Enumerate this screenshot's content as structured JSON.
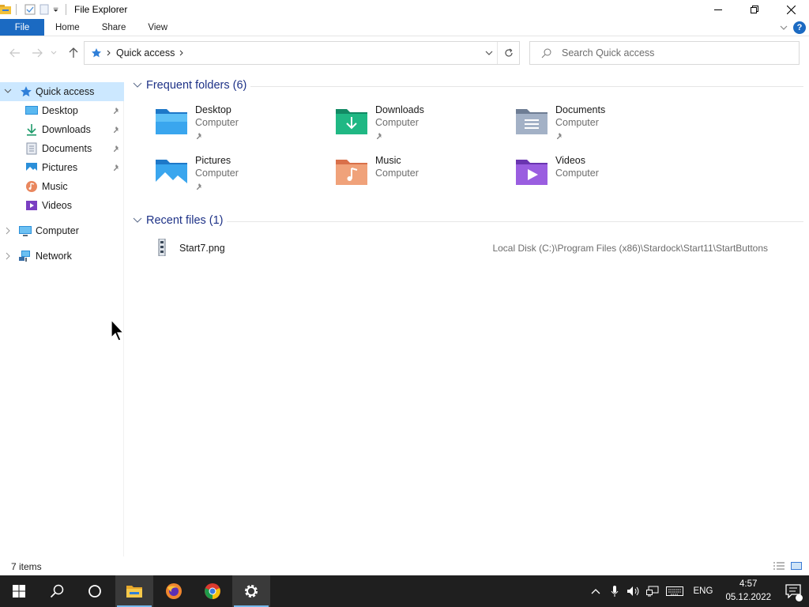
{
  "window": {
    "title": "File Explorer"
  },
  "ribbon": {
    "tabs": [
      "File",
      "Home",
      "Share",
      "View"
    ]
  },
  "address": {
    "location": "Quick access"
  },
  "search": {
    "placeholder": "Search Quick access"
  },
  "nav": {
    "quick_access": "Quick access",
    "items": [
      {
        "label": "Desktop",
        "icon": "desktop-icon",
        "pinned": true
      },
      {
        "label": "Downloads",
        "icon": "downloads-icon",
        "pinned": true
      },
      {
        "label": "Documents",
        "icon": "documents-icon",
        "pinned": true
      },
      {
        "label": "Pictures",
        "icon": "pictures-icon",
        "pinned": true
      },
      {
        "label": "Music",
        "icon": "music-icon",
        "pinned": false
      },
      {
        "label": "Videos",
        "icon": "videos-icon",
        "pinned": false
      }
    ],
    "computer": "Computer",
    "network": "Network"
  },
  "content": {
    "frequent_header": "Frequent folders (6)",
    "folders": [
      {
        "name": "Desktop",
        "sub": "Computer",
        "pinned": true,
        "icon": "desktop-folder-icon"
      },
      {
        "name": "Downloads",
        "sub": "Computer",
        "pinned": true,
        "icon": "downloads-folder-icon"
      },
      {
        "name": "Documents",
        "sub": "Computer",
        "pinned": true,
        "icon": "documents-folder-icon"
      },
      {
        "name": "Pictures",
        "sub": "Computer",
        "pinned": true,
        "icon": "pictures-folder-icon"
      },
      {
        "name": "Music",
        "sub": "Computer",
        "pinned": false,
        "icon": "music-folder-icon"
      },
      {
        "name": "Videos",
        "sub": "Computer",
        "pinned": false,
        "icon": "videos-folder-icon"
      }
    ],
    "recent_header": "Recent files (1)",
    "recent": [
      {
        "name": "Start7.png",
        "path": "Local Disk (C:)\\Program Files (x86)\\Stardock\\Start11\\StartButtons"
      }
    ]
  },
  "status": {
    "count": "7 items"
  },
  "taskbar": {
    "lang": "ENG",
    "time": "4:57",
    "date": "05.12.2022"
  },
  "colors": {
    "accent": "#1b6ac2",
    "selected_bg": "#cce8ff",
    "group_header": "#1e3287",
    "taskbar": "#1f1f1f"
  }
}
